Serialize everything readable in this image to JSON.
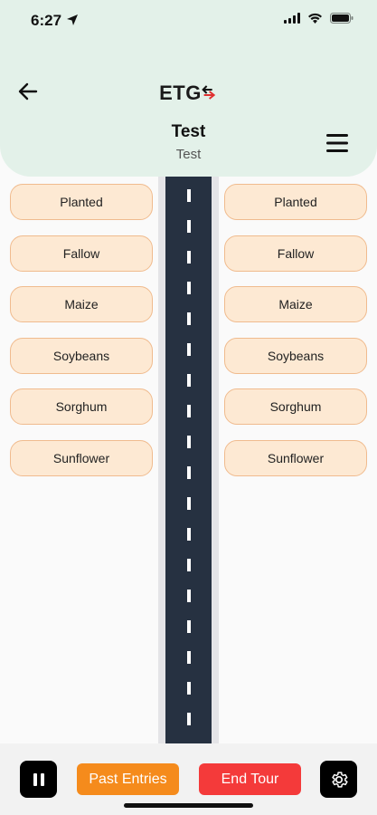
{
  "status_bar": {
    "time": "6:27"
  },
  "header": {
    "logo_text": "ETG",
    "title": "Test",
    "subtitle": "Test"
  },
  "left_column": [
    {
      "label": "Planted"
    },
    {
      "label": "Fallow"
    },
    {
      "label": "Maize"
    },
    {
      "label": "Soybeans"
    },
    {
      "label": "Sorghum"
    },
    {
      "label": "Sunflower"
    }
  ],
  "right_column": [
    {
      "label": "Planted"
    },
    {
      "label": "Fallow"
    },
    {
      "label": "Maize"
    },
    {
      "label": "Soybeans"
    },
    {
      "label": "Sorghum"
    },
    {
      "label": "Sunflower"
    }
  ],
  "footer": {
    "past_entries_label": "Past Entries",
    "end_tour_label": "End Tour"
  },
  "colors": {
    "header_bg": "#e3f1e9",
    "road": "#263141",
    "crop_button_bg": "#fde9d3",
    "crop_button_border": "#f0bb8e",
    "past_entries": "#f58b1c",
    "end_tour": "#f43a3a"
  },
  "icons": [
    "location-arrow-icon",
    "signal-icon",
    "wifi-icon",
    "battery-icon",
    "back-arrow-icon",
    "logo-arrows-icon",
    "hamburger-menu-icon",
    "pause-icon",
    "gear-icon"
  ]
}
